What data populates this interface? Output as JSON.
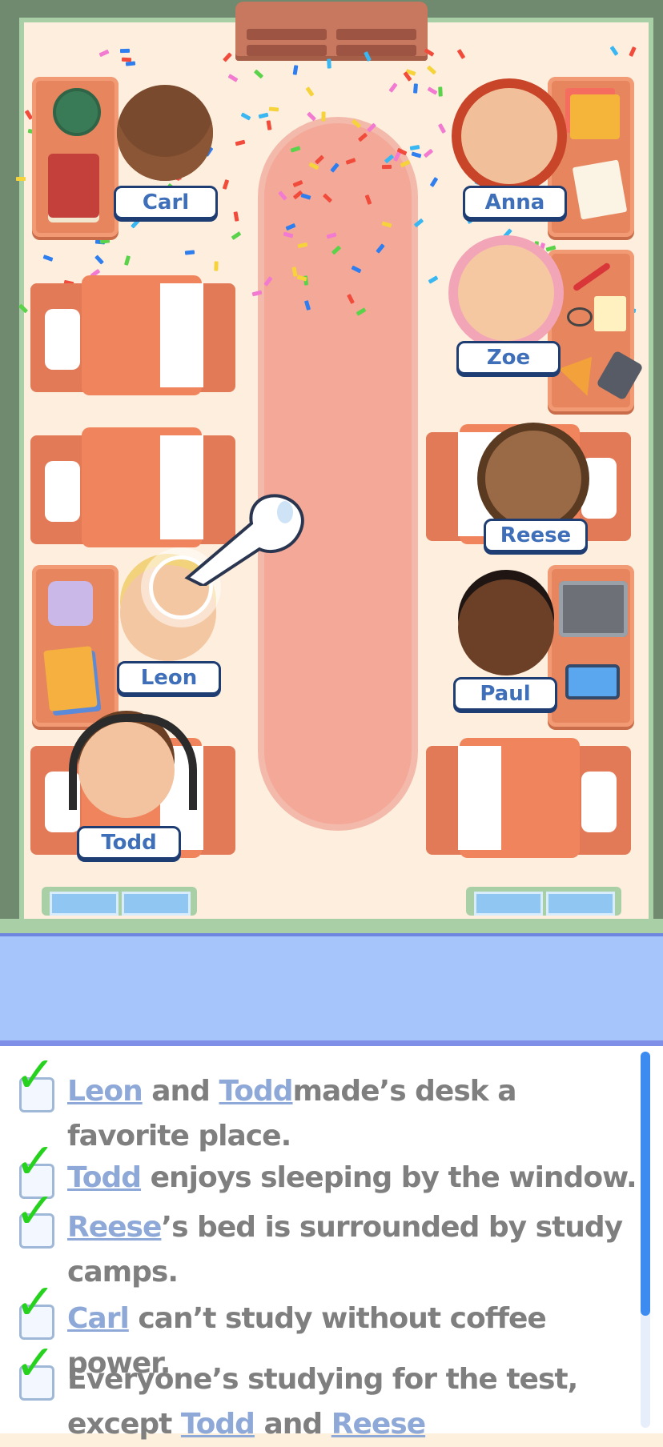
{
  "characters": {
    "carl": "Carl",
    "anna": "Anna",
    "zoe": "Zoe",
    "reese": "Reese",
    "leon": "Leon",
    "paul": "Paul",
    "todd": "Todd"
  },
  "clues": [
    {
      "parts": [
        {
          "t": "Leon",
          "name": true
        },
        {
          "t": " and ",
          "name": false
        },
        {
          "t": "Todd",
          "name": true
        },
        {
          "t": "made’s desk a favorite place.",
          "name": false
        }
      ]
    },
    {
      "parts": [
        {
          "t": "Todd",
          "name": true
        },
        {
          "t": " enjoys sleeping by the window.",
          "name": false
        }
      ]
    },
    {
      "parts": [
        {
          "t": "Reese",
          "name": true
        },
        {
          "t": "’s bed is surrounded by study camps.",
          "name": false
        }
      ]
    },
    {
      "parts": [
        {
          "t": "Carl",
          "name": true
        },
        {
          "t": " can’t study without coffee power.",
          "name": false
        }
      ]
    },
    {
      "parts": [
        {
          "t": "Everyone’s studying for the test, except ",
          "name": false
        },
        {
          "t": "Todd",
          "name": true
        },
        {
          "t": " and ",
          "name": false
        },
        {
          "t": "Reese",
          "name": true
        }
      ]
    }
  ],
  "colors": {
    "check": "#27d21e",
    "label_text": "#3e6fb8",
    "clue_text": "#7f7f7f",
    "clue_name": "#8ea9d8"
  },
  "icons": [
    "check-icon",
    "pointing-hand-icon",
    "coffee-cup-icon",
    "book-icon",
    "laptop-icon",
    "phone-icon",
    "calculator-icon",
    "pizza-icon",
    "glasses-icon",
    "headphones-icon",
    "earbuds-icon",
    "sticky-notes-icon"
  ]
}
